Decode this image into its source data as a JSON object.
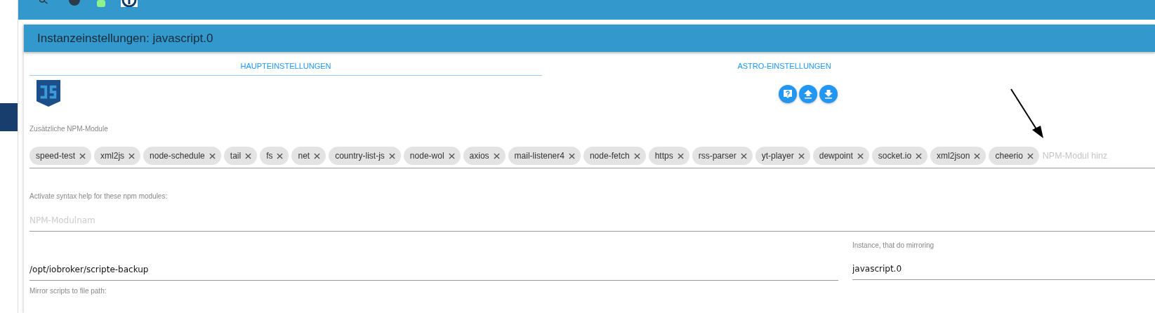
{
  "dialog": {
    "title": "Instanzeinstellungen: javascript.0"
  },
  "tabs": [
    {
      "label": "HAUPTEINSTELLUNGEN",
      "selected": true
    },
    {
      "label": "ASTRO-EINSTELLUNGEN",
      "selected": false
    }
  ],
  "npm_modules": {
    "label": "Zusätzliche NPM-Module",
    "placeholder": "NPM-Modul hinz",
    "chips": [
      "speed-test",
      "xml2js",
      "node-schedule",
      "tail",
      "fs",
      "net",
      "country-list-js",
      "node-wol",
      "axios",
      "mail-listener4",
      "node-fetch",
      "https",
      "rss-parser",
      "yt-player",
      "dewpoint",
      "socket.io",
      "xml2json",
      "cheerio"
    ]
  },
  "syntax_help": {
    "label": "Activate syntax help for these npm modules:",
    "placeholder": "NPM-Modulnam"
  },
  "mirror_path": {
    "value": "/opt/iobroker/scripte-backup",
    "label": "Mirror scripts to file path:"
  },
  "mirror_instance": {
    "label": "Instance, that do mirroring",
    "value": "javascript.0"
  }
}
